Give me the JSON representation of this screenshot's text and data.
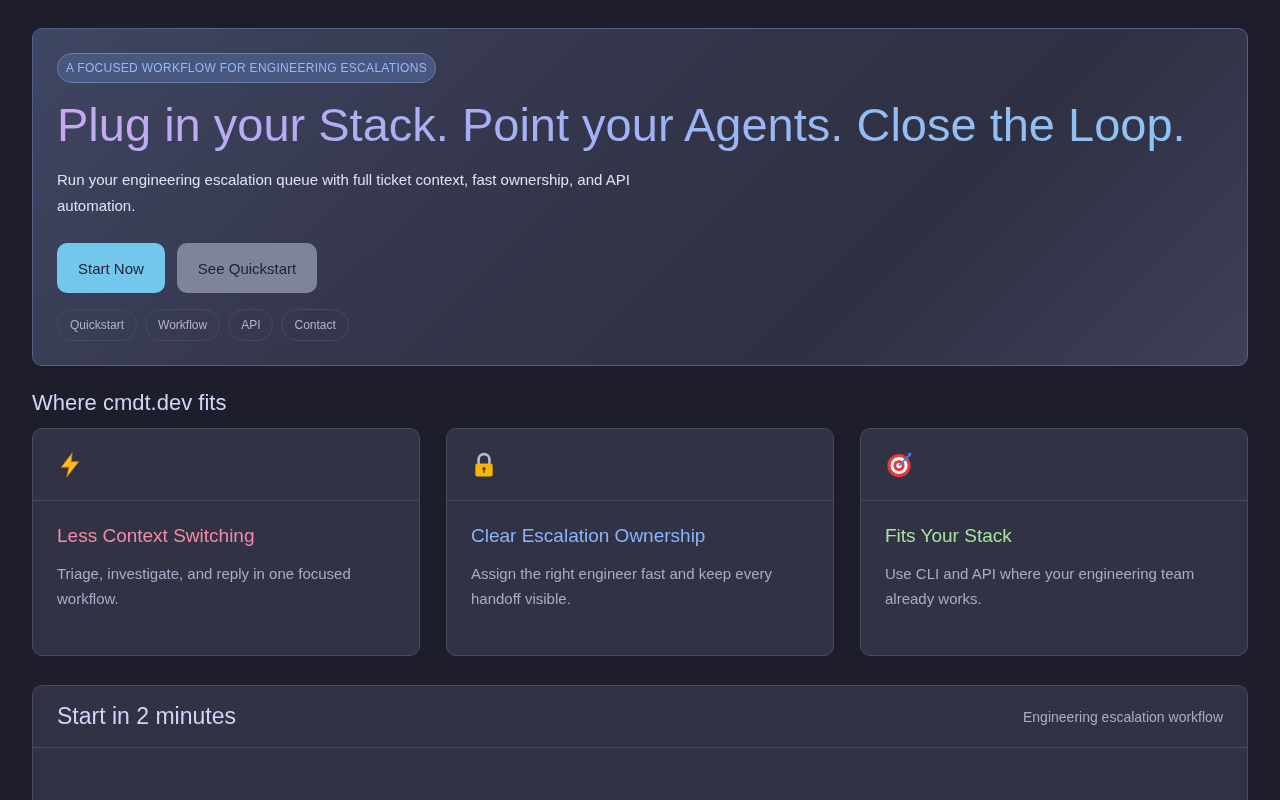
{
  "hero": {
    "badge": "A FOCUSED WORKFLOW FOR ENGINEERING ESCALATIONS",
    "title": "Plug in your Stack. Point your Agents. Close the Loop.",
    "description": "Run your engineering escalation queue with full ticket context, fast ownership, and API automation.",
    "buttons": [
      {
        "label": "Start Now",
        "kind": "primary"
      },
      {
        "label": "See Quickstart",
        "kind": "secondary"
      }
    ],
    "links": [
      "Quickstart",
      "Workflow",
      "API",
      "Contact"
    ]
  },
  "section_title": "Where cmdt.dev fits",
  "features": [
    {
      "kind": "bolt",
      "title": "Less Context Switching",
      "color": "#f38ba8",
      "description": "Triage, investigate, and reply in one focused workflow."
    },
    {
      "kind": "lock",
      "title": "Clear Escalation Ownership",
      "color": "#89b4fa",
      "description": "Assign the right engineer fast and keep every handoff visible."
    },
    {
      "kind": "target",
      "title": "Fits Your Stack",
      "color": "#a6e3a1",
      "description": "Use CLI and API where your engineering team already works."
    }
  ],
  "quickstart": {
    "title": "Start in 2 minutes",
    "meta": "Engineering escalation workflow"
  }
}
